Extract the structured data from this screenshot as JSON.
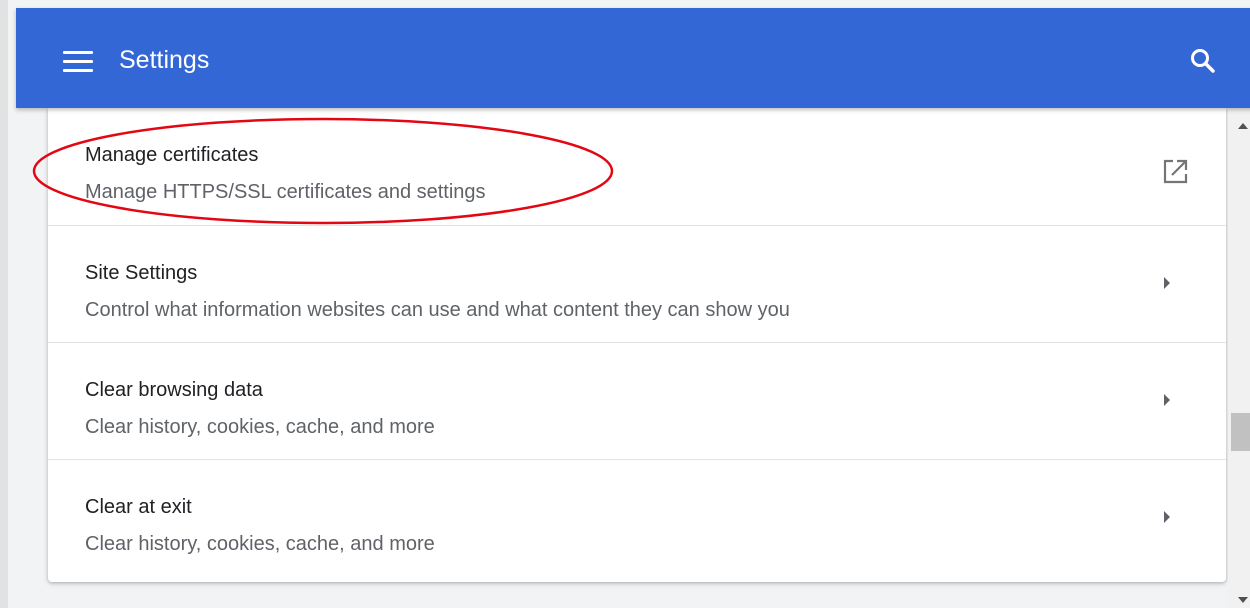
{
  "header": {
    "title": "Settings",
    "background_color": "#3367d6",
    "menu_icon": "hamburger-menu-icon",
    "search_icon": "search-icon"
  },
  "rows": [
    {
      "label": "Manage certificates",
      "sub": "Manage HTTPS/SSL certificates and settings",
      "action_icon": "open-in-new-icon"
    },
    {
      "label": "Site Settings",
      "sub": "Control what information websites can use and what content they can show you",
      "action_icon": "chevron-right-icon"
    },
    {
      "label": "Clear browsing data",
      "sub": "Clear history, cookies, cache, and more",
      "action_icon": "chevron-right-icon"
    },
    {
      "label": "Clear at exit",
      "sub": "Clear history, cookies, cache, and more",
      "action_icon": "chevron-right-icon"
    }
  ],
  "annotation": {
    "highlight_color": "#e30613",
    "highlighted_item": "Manage certificates"
  }
}
